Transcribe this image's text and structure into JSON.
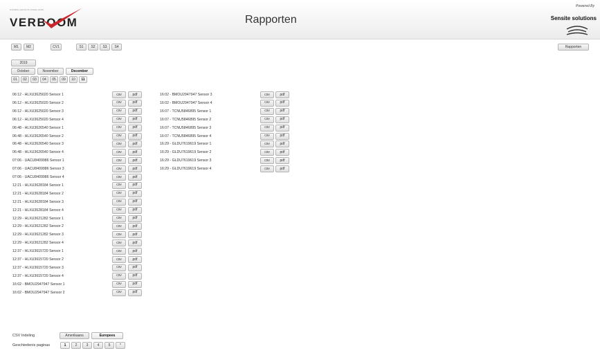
{
  "header": {
    "logo_small_text": "innovative systems for climate control",
    "logo_text": "VERBOOM",
    "title": "Rapporten",
    "powered_by": "Powered By",
    "sensite": "Sensite solutions"
  },
  "toolbar": {
    "machine_buttons": [
      "M1",
      "M2"
    ],
    "cv_button": "CV1",
    "sensor_buttons": [
      "S1",
      "S2",
      "S3",
      "S4"
    ],
    "rapporten_button": "Rapporten"
  },
  "year": "2019",
  "months": [
    {
      "label": "October",
      "active": false
    },
    {
      "label": "November",
      "active": false
    },
    {
      "label": "December",
      "active": true
    }
  ],
  "days": [
    {
      "label": "01",
      "active": false
    },
    {
      "label": "02",
      "active": false
    },
    {
      "label": "03",
      "active": false
    },
    {
      "label": "04",
      "active": false
    },
    {
      "label": "05",
      "active": false
    },
    {
      "label": "09",
      "active": false
    },
    {
      "label": "10",
      "active": false
    },
    {
      "label": "11",
      "active": true
    }
  ],
  "csv_label": "csv",
  "pdf_label": "pdf",
  "reports_left": [
    "06:12 - HLXU3625020 Sensor 1",
    "06:12 - HLXU3625020 Sensor 2",
    "06:12 - HLXU3625020 Sensor 3",
    "06:12 - HLXU3625020 Sensor 4",
    "06:48 - HLXU3626540 Sensor 1",
    "06:48 - HLXU3626540 Sensor 2",
    "06:48 - HLXU3626540 Sensor 3",
    "06:48 - HLXU3626540 Sensor 4",
    "07:06 - UACU8409986 Sensor 1",
    "07:06 - UACU8409986 Sensor 3",
    "07:06 - UACU8409986 Sensor 4",
    "12:21 - HLXU3628184 Sensor 1",
    "12:21 - HLXU3628184 Sensor 2",
    "12:21 - HLXU3628184 Sensor 3",
    "12:21 - HLXU3628184 Sensor 4",
    "12:29 - HLXU3621282 Sensor 1",
    "12:29 - HLXU3621282 Sensor 2",
    "12:29 - HLXU3621282 Sensor 3",
    "12:29 - HLXU3621282 Sensor 4",
    "12:37 - HLXU3615720 Sensor 1",
    "12:37 - HLXU3615720 Sensor 2",
    "12:37 - HLXU3615720 Sensor 3",
    "12:37 - HLXU3615720 Sensor 4",
    "16:02 - BMOU2947947 Sensor 1",
    "16:02 - BMOU2947947 Sensor 2"
  ],
  "reports_right": [
    "16:02 - BMOU2947947 Sensor 3",
    "16:02 - BMOU2947947 Sensor 4",
    "16:07 - TCNU5846895 Sensor 1",
    "16:07 - TCNU5846895 Sensor 2",
    "16:07 - TCNU5846895 Sensor 3",
    "16:07 - TCNU5846895 Sensor 4",
    "16:29 - GLDU7619619 Sensor 1",
    "16:29 - GLDU7619619 Sensor 2",
    "16:29 - GLDU7619619 Sensor 3",
    "16:29 - GLDU7619619 Sensor 4"
  ],
  "csv_format": {
    "label": "CSV Indeling",
    "options": [
      {
        "label": "Amerikaans",
        "active": false
      },
      {
        "label": "Europees",
        "active": true
      }
    ]
  },
  "history": {
    "label": "Geschiedenis paginas",
    "pages": [
      {
        "label": "1",
        "active": true
      },
      {
        "label": "2",
        "active": false
      },
      {
        "label": "3",
        "active": false
      },
      {
        "label": "4",
        "active": false
      },
      {
        "label": "5",
        "active": false
      },
      {
        "label": "*",
        "active": false
      }
    ]
  },
  "colors": {
    "accent_red": "#c8262c",
    "button_border": "#b3b3b3"
  }
}
